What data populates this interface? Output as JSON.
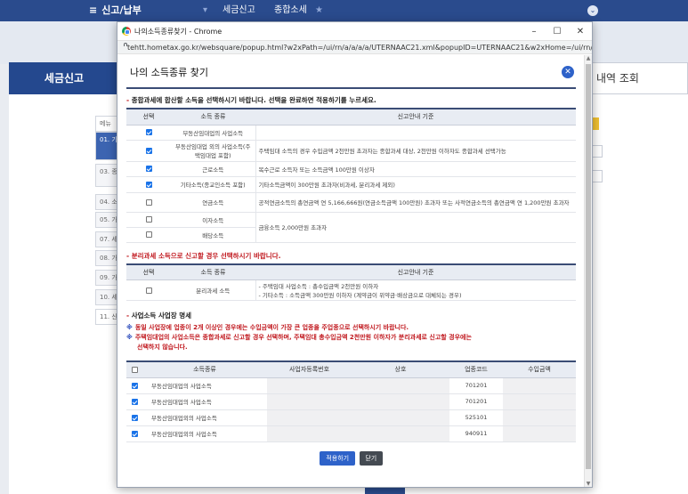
{
  "background": {
    "breadcrumb": [
      "신고/납부",
      "세금신고",
      "종합소세"
    ],
    "page_title": "세금신고",
    "right_title": "내역 조회",
    "side_items": [
      "메뉴",
      "01. 기 사",
      "03. 종 귀",
      "04. 소",
      "05. 가",
      "07. 세",
      "08. 가",
      "09. 가",
      "10. 세",
      "11. 신"
    ]
  },
  "window": {
    "title": "나의소득종류찾기 - Chrome",
    "controls": [
      "–",
      "☐",
      "✕"
    ],
    "url": "tehtt.hometax.go.kr/websquare/popup.html?w2xPath=/ui/rn/a/a/a/a/UTERNAAC21.xml&popupID=UTERNAAC21&w2xHome=/ui/rn/a..."
  },
  "popup": {
    "title": "나의 소득종류 찾기",
    "close_glyph": "✕",
    "section1": {
      "title": "종합과세에 합산할 소득을 선택하시기 바랍니다. 선택을 완료하면 적용하기를 누르세요.",
      "headers": [
        "선택",
        "소득 종류",
        "신고안내 기준"
      ],
      "rows": [
        {
          "checked": true,
          "type": "부동산임대업의 사업소득",
          "guide": ""
        },
        {
          "checked": true,
          "type": "부동산임대업 외의 사업소득(주택임대업 포함)",
          "guide": "주택임대 소득의 경우 수입금액 2천만원 초과자는 종합과세 대상, 2천만원 이하자도 종합과세 선택가능"
        },
        {
          "checked": true,
          "type": "근로소득",
          "guide": "복수근로 소득자 또는 소득금액 100만원 이상자"
        },
        {
          "checked": true,
          "type": "기타소득(종교인소득 포함)",
          "guide": "기타소득금액이 300만원 초과자(비과세, 분리과세 제외)"
        },
        {
          "checked": false,
          "type": "연금소득",
          "guide": "공적연금소득의 총연금액 연 5,166,666원(연금소득금액 100만원) 초과자 또는 사적연금소득의 총연금액 연 1,200만원 초과자"
        },
        {
          "checked": false,
          "type": "이자소득",
          "guide": "금융소득 2,000만원 초과자"
        },
        {
          "checked": false,
          "type": "배당소득",
          "guide": ""
        }
      ]
    },
    "section2": {
      "title": "분리과세 소득으로 신고할 경우 선택하시기 바랍니다.",
      "headers": [
        "선택",
        "소득 종류",
        "신고안내 기준"
      ],
      "row": {
        "checked": false,
        "type": "분리과세 소득",
        "guide_lines": [
          "- 주택임대 사업소득 : 총수입금액 2천만원 이하자",
          "- 기타소득 : 소득금액 300만원 이하자 (계약금이 위약금·배상금으로 대체되는 경우)"
        ]
      }
    },
    "section3": {
      "title": "사업소득 사업장 명세",
      "notice1": "동일 사업장에 업종이 2개 이상인 경우에는 수입금액이 가장 큰 업종을 주업종으로 선택하시기 바랍니다.",
      "notice2a": "주택임대업의 사업소득은 종합과세로 신고할 경우 선택하며, 주택임대 총수입금액 2천만원 이하자가 분리과세로 신고할 경우에는",
      "notice2b": "선택하지 않습니다.",
      "ref_mark": "※",
      "headers": [
        "소득종류",
        "사업자등록번호",
        "상호",
        "업종코드",
        "수입금액"
      ],
      "rows": [
        {
          "checked": true,
          "type": "부동산임대업의 사업소득",
          "code": "701201"
        },
        {
          "checked": true,
          "type": "부동산임대업의 사업소득",
          "code": "701201"
        },
        {
          "checked": true,
          "type": "부동산임대업외의 사업소득",
          "code": "525101"
        },
        {
          "checked": true,
          "type": "부동산임대업외의 사업소득",
          "code": "940911"
        }
      ]
    },
    "buttons": {
      "apply": "적용하기",
      "close": "닫기"
    }
  }
}
